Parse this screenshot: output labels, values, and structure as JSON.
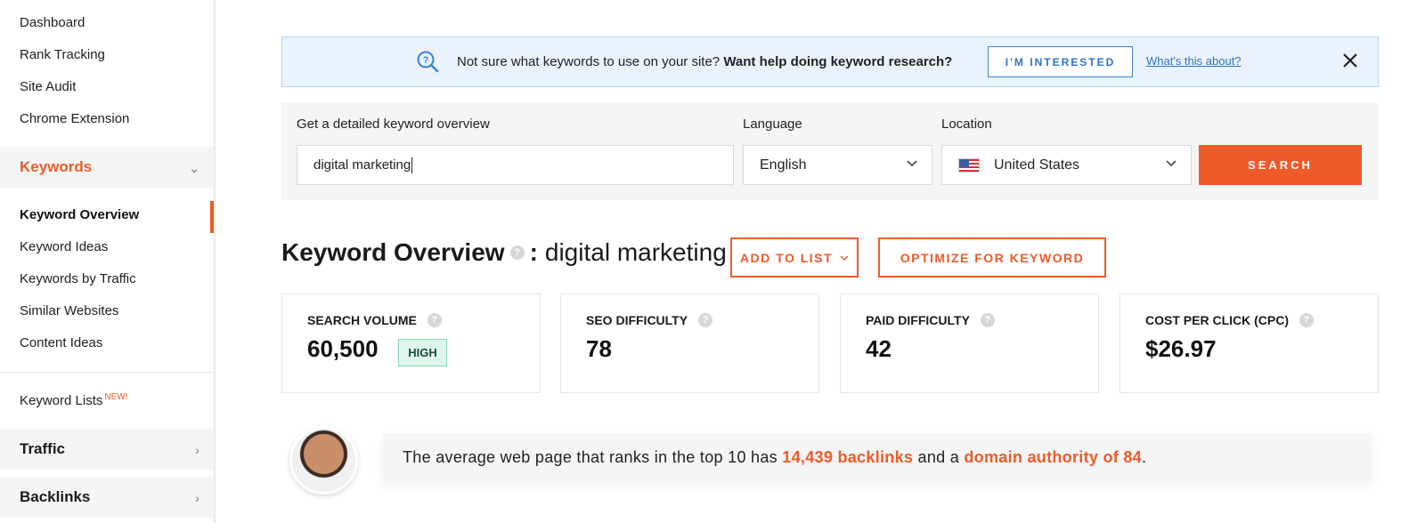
{
  "sidebar": {
    "top_items": [
      "Dashboard",
      "Rank Tracking",
      "Site Audit",
      "Chrome Extension"
    ],
    "keywords_section": "Keywords",
    "keyword_items": [
      "Keyword Overview",
      "Keyword Ideas",
      "Keywords by Traffic",
      "Similar Websites",
      "Content Ideas"
    ],
    "keyword_lists": "Keyword Lists",
    "keyword_lists_badge": "NEW!",
    "traffic_section": "Traffic",
    "backlinks_section": "Backlinks"
  },
  "banner": {
    "text": "Not sure what keywords to use on your site?",
    "text_bold": "Want help doing keyword research?",
    "button": "I'M INTERESTED",
    "link": "What's this about?"
  },
  "search": {
    "keyword_label": "Get a detailed keyword overview",
    "keyword_value": "digital marketing",
    "language_label": "Language",
    "language_value": "English",
    "location_label": "Location",
    "location_value": "United States",
    "button": "SEARCH"
  },
  "overview": {
    "title": "Keyword Overview",
    "separator": ":",
    "keyword": "digital marketing",
    "add_to_list": "ADD TO LIST",
    "optimize": "OPTIMIZE FOR KEYWORD"
  },
  "metrics": [
    {
      "label": "SEARCH VOLUME",
      "value": "60,500",
      "badge": "HIGH"
    },
    {
      "label": "SEO DIFFICULTY",
      "value": "78"
    },
    {
      "label": "PAID DIFFICULTY",
      "value": "42"
    },
    {
      "label": "COST PER CLICK (CPC)",
      "value": "$26.97"
    }
  ],
  "insight": {
    "prefix": "The average web page that ranks in the top 10 has",
    "backlinks": "14,439 backlinks",
    "middle": "and a",
    "authority": "domain authority of 84",
    "suffix": "."
  },
  "colors": {
    "accent": "#f05a28",
    "link": "#2e73c7",
    "banner_bg": "#eaf3fd"
  }
}
